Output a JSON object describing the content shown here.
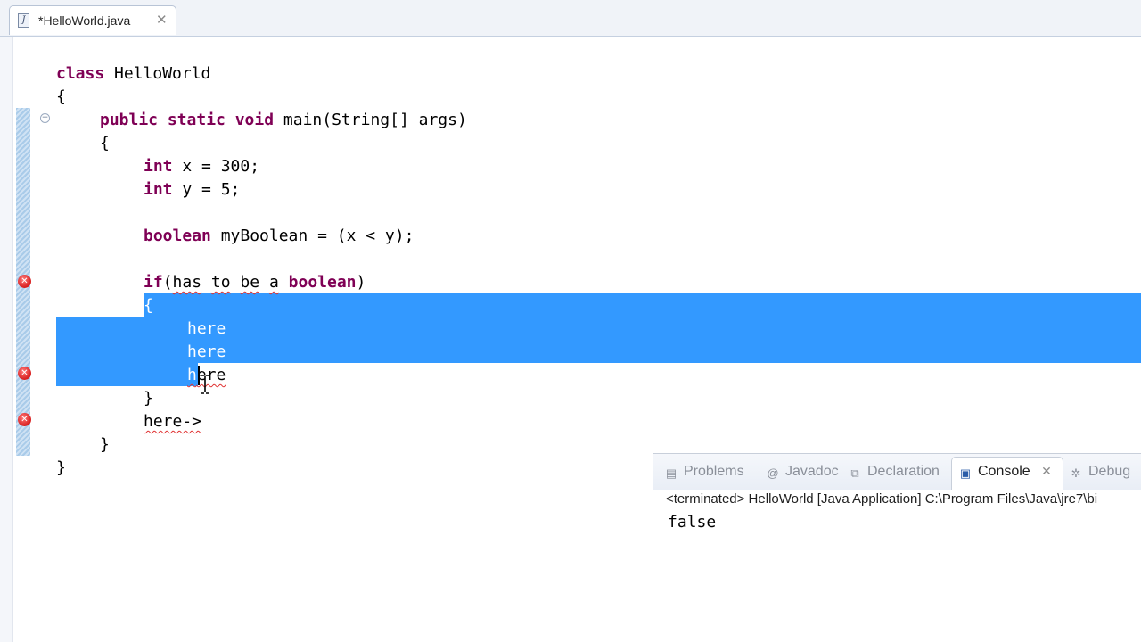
{
  "editor": {
    "tab_title": "*HelloWorld.java",
    "tab_close": "✕",
    "file_icon_glyph": "J"
  },
  "code": {
    "line1_kw": "class",
    "line1_rest": " HelloWorld",
    "line2": "{",
    "line3_kw": "public static void",
    "line3_rest": " main(String[] args)",
    "line4": "{",
    "line5_kw": "int",
    "line5_rest": " x = 300;",
    "line6_kw": "int",
    "line6_rest": " y = 5;",
    "line7_kw": "boolean",
    "line7_rest": " myBoolean = (x < y);",
    "line8_kw_if": "if",
    "line8_open": "(",
    "line8_has": "has",
    "line8_to": "to",
    "line8_be": "be",
    "line8_a": "a",
    "line8_kw_boolean": "boolean",
    "line8_close": ")",
    "line9": "{",
    "line10": "here",
    "line11": "here",
    "line12_h": "h",
    "line12_rest": "ere",
    "line13": "}",
    "line14": "here->",
    "line15": "}",
    "line16": "}"
  },
  "console": {
    "tabs": {
      "problems": "Problems",
      "javadoc": "Javadoc",
      "declaration": "Declaration",
      "console": "Console",
      "debug": "Debug"
    },
    "close_glyph": "✕",
    "status": "<terminated> HelloWorld [Java Application] C:\\Program Files\\Java\\jre7\\bi",
    "output": "false"
  },
  "colors": {
    "keyword": "#7f0055",
    "selection": "#3399ff",
    "error": "#d81e1e"
  }
}
